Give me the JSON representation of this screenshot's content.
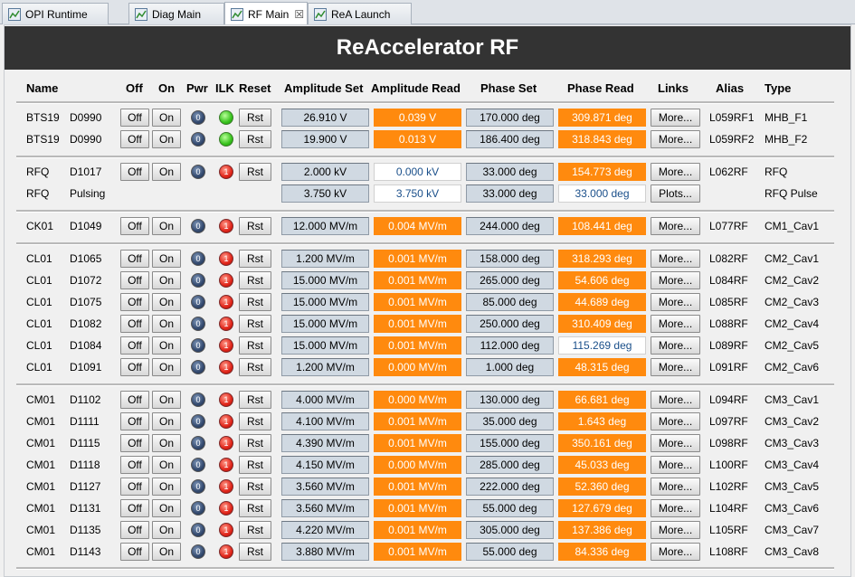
{
  "tabs": [
    {
      "label": "OPI Runtime",
      "icon": "opi-icon"
    },
    {
      "label": "Diag Main",
      "icon": "opi-icon"
    },
    {
      "label": "RF Main",
      "icon": "opi-icon",
      "close": "☒"
    },
    {
      "label": "ReA Launch",
      "icon": "opi-icon"
    }
  ],
  "title": "ReAccelerator RF",
  "headers": {
    "name": "Name",
    "off": "Off",
    "on": "On",
    "pwr": "Pwr",
    "ilk": "ILK",
    "reset": "Reset",
    "amp_set": "Amplitude Set",
    "amp_read": "Amplitude Read",
    "phase_set": "Phase Set",
    "phase_read": "Phase Read",
    "links": "Links",
    "alias": "Alias",
    "type": "Type"
  },
  "labels": {
    "off": "Off",
    "on": "On",
    "rst": "Rst",
    "more": "More...",
    "plots": "Plots..."
  },
  "colors": {
    "banner": "#333333",
    "read_alarm": "#ff8a0e",
    "setpoint": "#d0d9e2",
    "ilk_ok": "#37c21c",
    "ilk_fault": "#e1251a",
    "pwr": "#33496e"
  },
  "rows": [
    {
      "sys": "BTS19",
      "dev": "D0990",
      "ctrl": true,
      "pwr": "0",
      "ilk": "green",
      "ilk_text": "",
      "amp_set": "26.910 V",
      "amp_read": "0.039 V",
      "amp_state": "alarm",
      "phase_set": "170.000 deg",
      "phase_read": "309.871 deg",
      "phase_state": "alarm",
      "link": "More...",
      "alias": "L059RF1",
      "type": "MHB_F1"
    },
    {
      "sys": "BTS19",
      "dev": "D0990",
      "ctrl": true,
      "pwr": "0",
      "ilk": "green",
      "ilk_text": "",
      "amp_set": "19.900 V",
      "amp_read": "0.013 V",
      "amp_state": "alarm",
      "phase_set": "186.400 deg",
      "phase_read": "318.843 deg",
      "phase_state": "alarm",
      "link": "More...",
      "alias": "L059RF2",
      "type": "MHB_F2"
    },
    {
      "sep": true
    },
    {
      "sys": "RFQ",
      "dev": "D1017",
      "ctrl": true,
      "pwr": "0",
      "ilk": "red",
      "ilk_text": "1",
      "amp_set": "2.000 kV",
      "amp_read": "0.000 kV",
      "amp_state": "ok",
      "phase_set": "33.000 deg",
      "phase_read": "154.773 deg",
      "phase_state": "alarm",
      "link": "More...",
      "alias": "L062RF",
      "type": "RFQ"
    },
    {
      "sys": "RFQ",
      "dev": "Pulsing",
      "ctrl": false,
      "amp_set": "3.750 kV",
      "amp_read": "3.750 kV",
      "amp_state": "ok",
      "phase_set": "33.000 deg",
      "phase_read": "33.000 deg",
      "phase_state": "ok",
      "link": "Plots...",
      "alias": "",
      "type": "RFQ Pulse"
    },
    {
      "sep": true
    },
    {
      "sys": "CK01",
      "dev": "D1049",
      "ctrl": true,
      "pwr": "0",
      "ilk": "red",
      "ilk_text": "1",
      "amp_set": "12.000 MV/m",
      "amp_read": "0.004 MV/m",
      "amp_state": "alarm",
      "phase_set": "244.000 deg",
      "phase_read": "108.441 deg",
      "phase_state": "alarm",
      "link": "More...",
      "alias": "L077RF",
      "type": "CM1_Cav1"
    },
    {
      "sep": true
    },
    {
      "sys": "CL01",
      "dev": "D1065",
      "ctrl": true,
      "pwr": "0",
      "ilk": "red",
      "ilk_text": "1",
      "amp_set": "1.200 MV/m",
      "amp_read": "0.001 MV/m",
      "amp_state": "alarm",
      "phase_set": "158.000 deg",
      "phase_read": "318.293 deg",
      "phase_state": "alarm",
      "link": "More...",
      "alias": "L082RF",
      "type": "CM2_Cav1"
    },
    {
      "sys": "CL01",
      "dev": "D1072",
      "ctrl": true,
      "pwr": "0",
      "ilk": "red",
      "ilk_text": "1",
      "amp_set": "15.000 MV/m",
      "amp_read": "0.001 MV/m",
      "amp_state": "alarm",
      "phase_set": "265.000 deg",
      "phase_read": "54.606 deg",
      "phase_state": "alarm",
      "link": "More...",
      "alias": "L084RF",
      "type": "CM2_Cav2"
    },
    {
      "sys": "CL01",
      "dev": "D1075",
      "ctrl": true,
      "pwr": "0",
      "ilk": "red",
      "ilk_text": "1",
      "amp_set": "15.000 MV/m",
      "amp_read": "0.001 MV/m",
      "amp_state": "alarm",
      "phase_set": "85.000 deg",
      "phase_read": "44.689 deg",
      "phase_state": "alarm",
      "link": "More...",
      "alias": "L085RF",
      "type": "CM2_Cav3"
    },
    {
      "sys": "CL01",
      "dev": "D1082",
      "ctrl": true,
      "pwr": "0",
      "ilk": "red",
      "ilk_text": "1",
      "amp_set": "15.000 MV/m",
      "amp_read": "0.001 MV/m",
      "amp_state": "alarm",
      "phase_set": "250.000 deg",
      "phase_read": "310.409 deg",
      "phase_state": "alarm",
      "link": "More...",
      "alias": "L088RF",
      "type": "CM2_Cav4"
    },
    {
      "sys": "CL01",
      "dev": "D1084",
      "ctrl": true,
      "pwr": "0",
      "ilk": "red",
      "ilk_text": "1",
      "amp_set": "15.000 MV/m",
      "amp_read": "0.001 MV/m",
      "amp_state": "alarm",
      "phase_set": "112.000 deg",
      "phase_read": "115.269 deg",
      "phase_state": "ok",
      "link": "More...",
      "alias": "L089RF",
      "type": "CM2_Cav5"
    },
    {
      "sys": "CL01",
      "dev": "D1091",
      "ctrl": true,
      "pwr": "0",
      "ilk": "red",
      "ilk_text": "1",
      "amp_set": "1.200 MV/m",
      "amp_read": "0.000 MV/m",
      "amp_state": "alarm",
      "phase_set": "1.000 deg",
      "phase_read": "48.315 deg",
      "phase_state": "alarm",
      "link": "More...",
      "alias": "L091RF",
      "type": "CM2_Cav6"
    },
    {
      "sep": true
    },
    {
      "sys": "CM01",
      "dev": "D1102",
      "ctrl": true,
      "pwr": "0",
      "ilk": "red",
      "ilk_text": "1",
      "amp_set": "4.000 MV/m",
      "amp_read": "0.000 MV/m",
      "amp_state": "alarm",
      "phase_set": "130.000 deg",
      "phase_read": "66.681 deg",
      "phase_state": "alarm",
      "link": "More...",
      "alias": "L094RF",
      "type": "CM3_Cav1"
    },
    {
      "sys": "CM01",
      "dev": "D1111",
      "ctrl": true,
      "pwr": "0",
      "ilk": "red",
      "ilk_text": "1",
      "amp_set": "4.100 MV/m",
      "amp_read": "0.001 MV/m",
      "amp_state": "alarm",
      "phase_set": "35.000 deg",
      "phase_read": "1.643 deg",
      "phase_state": "alarm",
      "link": "More...",
      "alias": "L097RF",
      "type": "CM3_Cav2"
    },
    {
      "sys": "CM01",
      "dev": "D1115",
      "ctrl": true,
      "pwr": "0",
      "ilk": "red",
      "ilk_text": "1",
      "amp_set": "4.390 MV/m",
      "amp_read": "0.001 MV/m",
      "amp_state": "alarm",
      "phase_set": "155.000 deg",
      "phase_read": "350.161 deg",
      "phase_state": "alarm",
      "link": "More...",
      "alias": "L098RF",
      "type": "CM3_Cav3"
    },
    {
      "sys": "CM01",
      "dev": "D1118",
      "ctrl": true,
      "pwr": "0",
      "ilk": "red",
      "ilk_text": "1",
      "amp_set": "4.150 MV/m",
      "amp_read": "0.000 MV/m",
      "amp_state": "alarm",
      "phase_set": "285.000 deg",
      "phase_read": "45.033 deg",
      "phase_state": "alarm",
      "link": "More...",
      "alias": "L100RF",
      "type": "CM3_Cav4"
    },
    {
      "sys": "CM01",
      "dev": "D1127",
      "ctrl": true,
      "pwr": "0",
      "ilk": "red",
      "ilk_text": "1",
      "amp_set": "3.560 MV/m",
      "amp_read": "0.001 MV/m",
      "amp_state": "alarm",
      "phase_set": "222.000 deg",
      "phase_read": "52.360 deg",
      "phase_state": "alarm",
      "link": "More...",
      "alias": "L102RF",
      "type": "CM3_Cav5"
    },
    {
      "sys": "CM01",
      "dev": "D1131",
      "ctrl": true,
      "pwr": "0",
      "ilk": "red",
      "ilk_text": "1",
      "amp_set": "3.560 MV/m",
      "amp_read": "0.001 MV/m",
      "amp_state": "alarm",
      "phase_set": "55.000 deg",
      "phase_read": "127.679 deg",
      "phase_state": "alarm",
      "link": "More...",
      "alias": "L104RF",
      "type": "CM3_Cav6"
    },
    {
      "sys": "CM01",
      "dev": "D1135",
      "ctrl": true,
      "pwr": "0",
      "ilk": "red",
      "ilk_text": "1",
      "amp_set": "4.220 MV/m",
      "amp_read": "0.001 MV/m",
      "amp_state": "alarm",
      "phase_set": "305.000 deg",
      "phase_read": "137.386 deg",
      "phase_state": "alarm",
      "link": "More...",
      "alias": "L105RF",
      "type": "CM3_Cav7"
    },
    {
      "sys": "CM01",
      "dev": "D1143",
      "ctrl": true,
      "pwr": "0",
      "ilk": "red",
      "ilk_text": "1",
      "amp_set": "3.880 MV/m",
      "amp_read": "0.001 MV/m",
      "amp_state": "alarm",
      "phase_set": "55.000 deg",
      "phase_read": "84.336 deg",
      "phase_state": "alarm",
      "link": "More...",
      "alias": "L108RF",
      "type": "CM3_Cav8"
    },
    {
      "sep": true
    }
  ]
}
